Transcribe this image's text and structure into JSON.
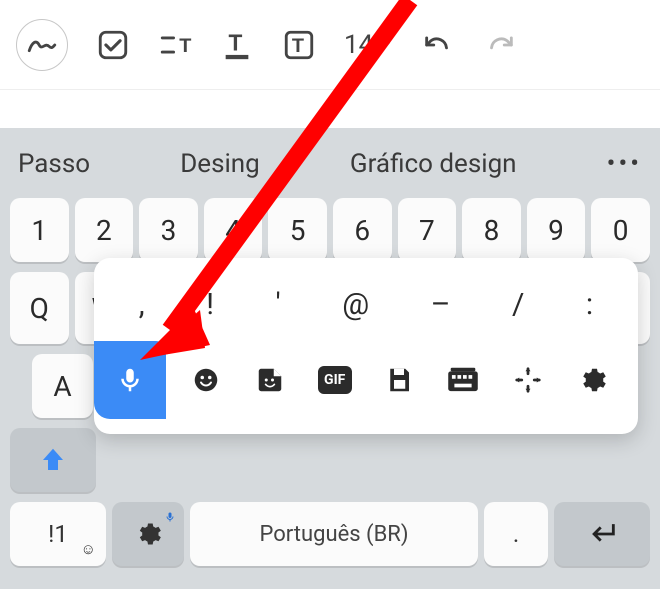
{
  "toolbar": {
    "font_size": "14"
  },
  "suggestions": {
    "s1": "Passo",
    "s2": "Desing",
    "s3": "Gráfico design"
  },
  "keys": {
    "numbers": [
      "1",
      "2",
      "3",
      "4",
      "5",
      "6",
      "7",
      "8",
      "9",
      "0"
    ],
    "row_q": [
      "Q",
      "W"
    ],
    "row_a_first": "A",
    "symbols_label": "!1",
    "space_label": "Português (BR)",
    "period": "."
  },
  "popup": {
    "punctuation": [
      ",",
      "!",
      "'",
      "@",
      "–",
      "/",
      ":"
    ],
    "gif_label": "GIF"
  },
  "iconsets": {
    "mic": "mic-icon",
    "emoji": "emoji-icon",
    "sticker": "sticker-icon",
    "gif": "gif-icon",
    "save": "save-icon",
    "keyboard": "keyboard-icon",
    "move": "move-icon",
    "gear": "gear-icon"
  }
}
